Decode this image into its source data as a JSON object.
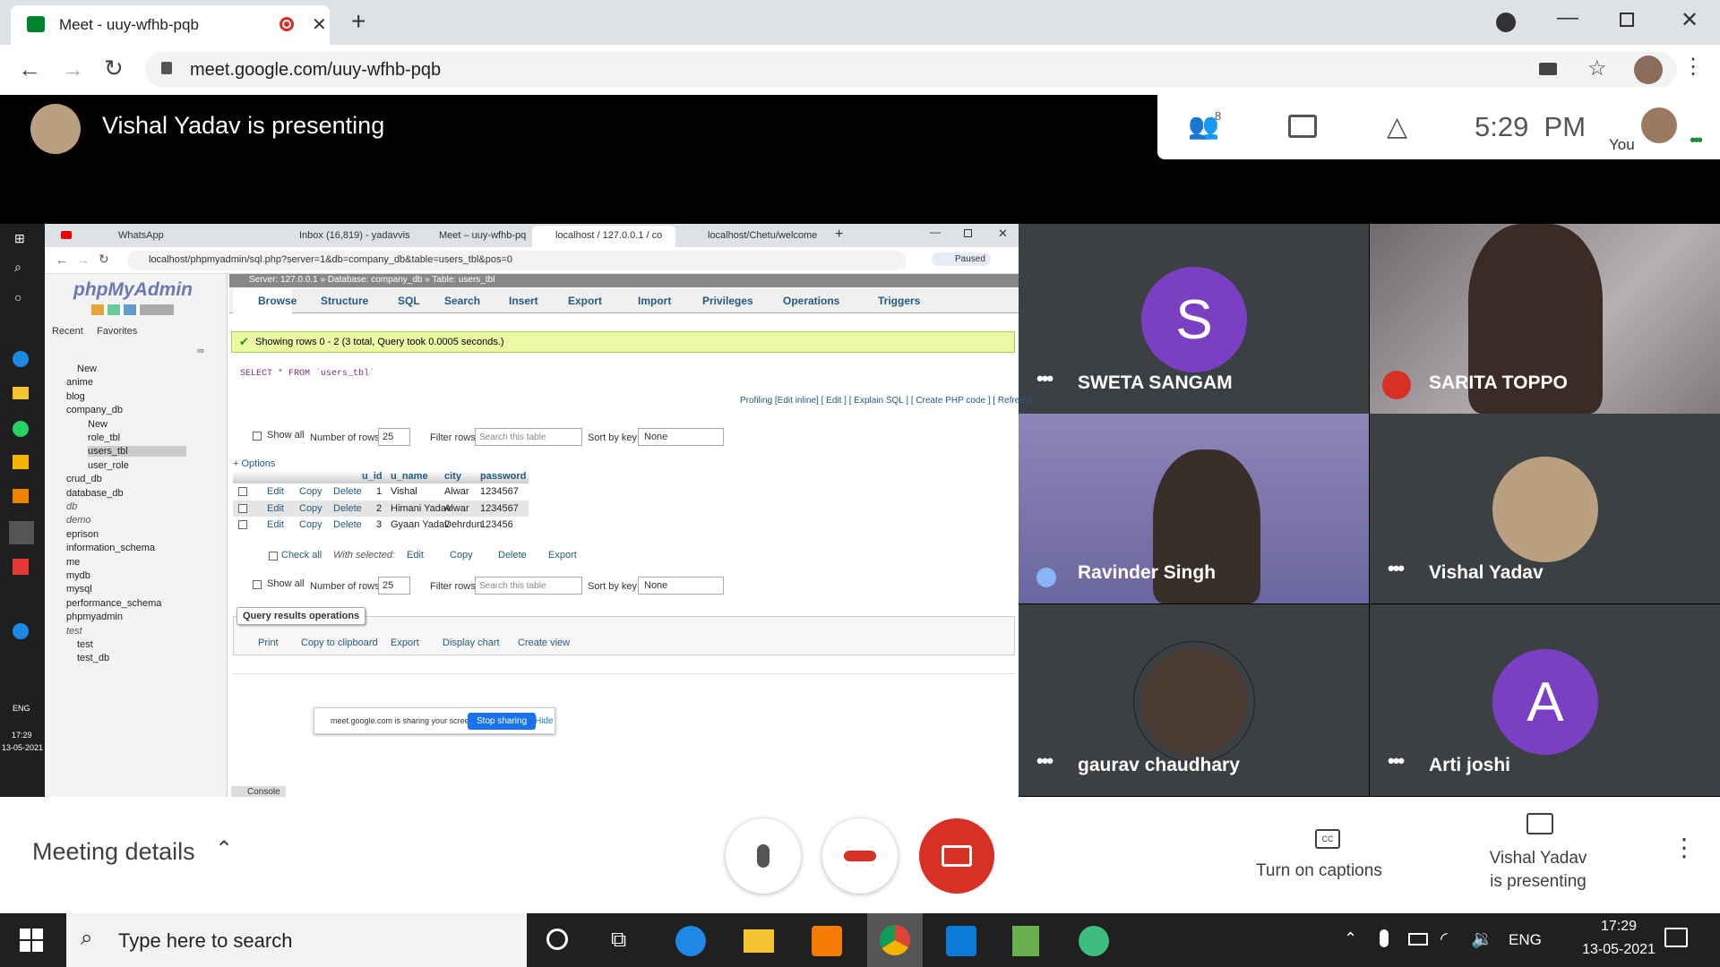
{
  "browser": {
    "tab_title": "Meet - uuy-wfhb-pqb",
    "url": "meet.google.com/uuy-wfhb-pqb"
  },
  "meet": {
    "presenter_banner": "Vishal Yadav is presenting",
    "people_count": "8",
    "time": "5:29  PM",
    "you_label": "You",
    "meeting_details": "Meeting details",
    "captions_label": "Turn on captions",
    "presenting_label_1": "Vishal Yadav",
    "presenting_label_2": "is presenting",
    "participants": [
      {
        "name": "SWETA SANGAM",
        "initial": "S",
        "color": "#7b3fc4"
      },
      {
        "name": "SARITA TOPPO"
      },
      {
        "name": "Ravinder Singh"
      },
      {
        "name": "Vishal Yadav"
      },
      {
        "name": "gaurav chaudhary"
      },
      {
        "name": "Arti joshi",
        "initial": "A",
        "color": "#7b3fc4"
      }
    ]
  },
  "shared": {
    "tabs": [
      "WhatsApp",
      "Inbox (16,819) - yadavvis",
      "Meet – uuy-wfhb-pq",
      "localhost / 127.0.0.1 / co",
      "localhost/Chetu/welcome"
    ],
    "url": "localhost/phpmyadmin/sql.php?server=1&db=company_db&table=users_tbl&pos=0",
    "paused": "Paused",
    "pma_logo": "phpMyAdmin",
    "recent": "Recent",
    "favorites": "Favorites",
    "breadcrumb": "Server: 127.0.0.1 » Database: company_db » Table: users_tbl",
    "pma_tabs": [
      "Browse",
      "Structure",
      "SQL",
      "Search",
      "Insert",
      "Export",
      "Import",
      "Privileges",
      "Operations",
      "Triggers"
    ],
    "success": "Showing rows 0 - 2 (3 total, Query took 0.0005 seconds.)",
    "query": "SELECT * FROM `users_tbl`",
    "profiling": "Profiling [Edit inline] [ Edit ] [ Explain SQL ] [ Create PHP code ] [ Refresh]",
    "show_all": "Show all",
    "num_rows_label": "Number of rows:",
    "num_rows": "25",
    "filter_label": "Filter rows:",
    "filter_placeholder": "Search this table",
    "sort_label": "Sort by key:",
    "sort_value": "None",
    "options": "+ Options",
    "columns": [
      "u_id",
      "u_name",
      "city",
      "password"
    ],
    "rows": [
      [
        "1",
        "Vishal",
        "Alwar",
        "1234567"
      ],
      [
        "2",
        "Himani Yadav",
        "Alwar",
        "1234567"
      ],
      [
        "3",
        "Gyaan Yadav",
        "Dehrdun",
        "123456"
      ]
    ],
    "row_actions": {
      "edit": "Edit",
      "copy": "Copy",
      "delete": "Delete"
    },
    "check_all": "Check all",
    "with_selected": "With selected:",
    "export": "Export",
    "qro_title": "Query results operations",
    "qro_links": [
      "Print",
      "Copy to clipboard",
      "Export",
      "Display chart",
      "Create view"
    ],
    "sharing_msg": "meet.google.com is sharing your screen.",
    "stop_sharing": "Stop sharing",
    "hide": "Hide",
    "console": "Console",
    "tree": [
      "New",
      "anime",
      "blog",
      "company_db",
      "New",
      "role_tbl",
      "users_tbl",
      "user_role",
      "crud_db",
      "database_db",
      "db",
      "demo",
      "eprison",
      "information_schema",
      "me",
      "mydb",
      "mysql",
      "performance_schema",
      "phpmyadmin",
      "test",
      "test",
      "test_db"
    ],
    "inner_clock": "17:29",
    "inner_date": "13-05-2021",
    "inner_lang": "ENG"
  },
  "taskbar": {
    "search": "Type here to search",
    "lang": "ENG",
    "time": "17:29",
    "date": "13-05-2021"
  }
}
